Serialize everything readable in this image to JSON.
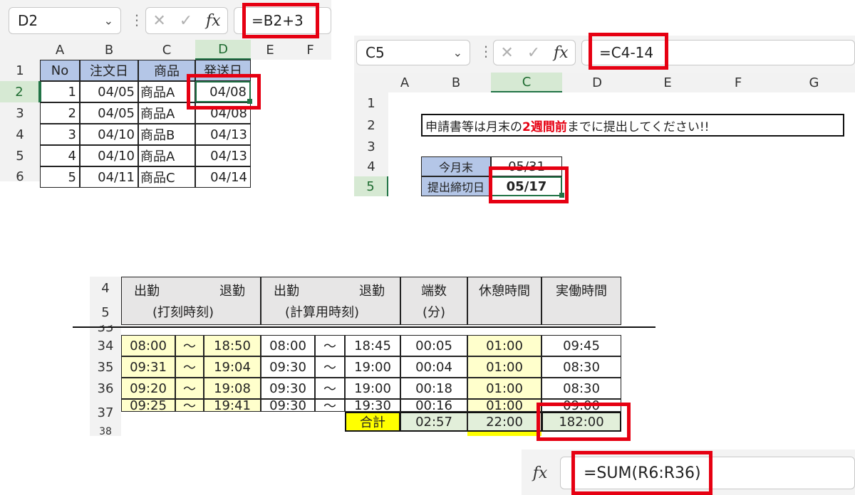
{
  "panel1": {
    "name_box": "D2",
    "formula": "=B2+3",
    "columns": [
      "A",
      "B",
      "C",
      "D",
      "E",
      "F"
    ],
    "rows": [
      "1",
      "2",
      "3",
      "4",
      "5",
      "6"
    ],
    "header": [
      "No",
      "注文日",
      "商品",
      "発送日"
    ],
    "data": [
      [
        "1",
        "04/05",
        "商品A",
        "04/08"
      ],
      [
        "2",
        "04/05",
        "商品A",
        "04/08"
      ],
      [
        "3",
        "04/10",
        "商品B",
        "04/13"
      ],
      [
        "4",
        "04/10",
        "商品A",
        "04/13"
      ],
      [
        "5",
        "04/11",
        "商品C",
        "04/14"
      ]
    ]
  },
  "panel2": {
    "name_box": "C5",
    "formula": "=C4-14",
    "columns": [
      "A",
      "B",
      "C",
      "D",
      "E",
      "F",
      "G"
    ],
    "rows": [
      "1",
      "2",
      "3",
      "4",
      "5"
    ],
    "notice_pre": "申請書等は月末の",
    "notice_red": "2週間前",
    "notice_post": "までに提出してください!!",
    "label_month_end": "今月末",
    "value_month_end": "05/31",
    "label_deadline": "提出締切日",
    "value_deadline": "05/17"
  },
  "panel3": {
    "rows": [
      "4",
      "5",
      "33",
      "34",
      "35",
      "36",
      "37",
      "38"
    ],
    "h_in": "出勤",
    "h_out": "退勤",
    "h_stamp": "(打刻時刻)",
    "h_calc": "(計算用時刻)",
    "h_frac": "端数",
    "h_frac_unit": "(分)",
    "h_break": "休憩時間",
    "h_work": "実働時間",
    "tilde": "～",
    "data": [
      [
        "08:00",
        "18:50",
        "08:00",
        "18:45",
        "00:05",
        "01:00",
        "09:45"
      ],
      [
        "09:31",
        "19:04",
        "09:30",
        "19:00",
        "00:04",
        "01:00",
        "08:30"
      ],
      [
        "09:20",
        "19:08",
        "09:30",
        "19:00",
        "00:18",
        "01:00",
        "08:30"
      ],
      [
        "09:25",
        "19:41",
        "09:30",
        "19:30",
        "00:16",
        "01:00",
        "09:00"
      ]
    ],
    "total_label": "合計",
    "total_frac": "02:57",
    "total_break": "22:00",
    "total_work": "182:00",
    "formula": "=SUM(R6:R36)"
  },
  "icons": [
    "chevron-down-icon",
    "cancel-x-icon",
    "check-icon",
    "fx-icon",
    "more-dots-icon"
  ]
}
